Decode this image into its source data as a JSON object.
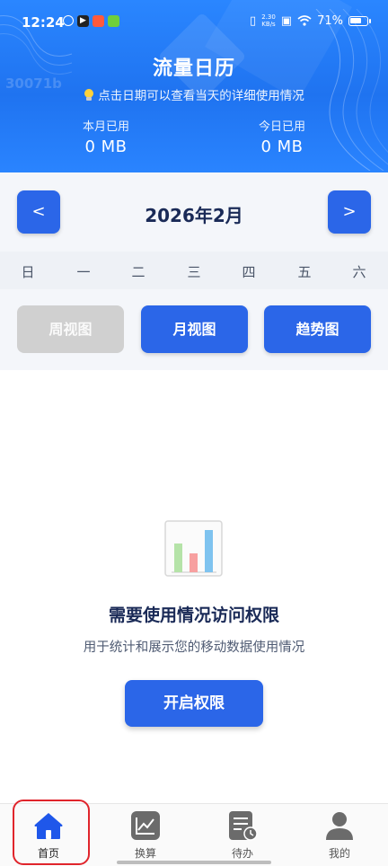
{
  "status_bar": {
    "time": "12:24",
    "net_speed_value": "2.30",
    "net_speed_unit": "KB/s",
    "battery_percent": "71%",
    "battery_level": 0.71
  },
  "header": {
    "watermark": "30071b",
    "title": "流量日历",
    "hint": "点击日期可以查看当天的详细使用情况",
    "month_used_label": "本月已用",
    "month_used_value": "0 MB",
    "today_used_label": "今日已用",
    "today_used_value": "0 MB"
  },
  "calendar": {
    "prev_label": "<",
    "next_label": ">",
    "month_label": "2026年2月",
    "weekdays": [
      "日",
      "一",
      "二",
      "三",
      "四",
      "五",
      "六"
    ]
  },
  "views": {
    "week": "周视图",
    "month": "月视图",
    "trend": "趋势图"
  },
  "permission": {
    "title": "需要使用情况访问权限",
    "description": "用于统计和展示您的移动数据使用情况",
    "button": "开启权限"
  },
  "bottom_nav": {
    "home": "首页",
    "convert": "换算",
    "todo": "待办",
    "mine": "我的"
  },
  "colors": {
    "primary": "#2b66e8",
    "header": "#2a86ff",
    "disabled": "#d0d0d0",
    "highlight": "#e0242b"
  }
}
